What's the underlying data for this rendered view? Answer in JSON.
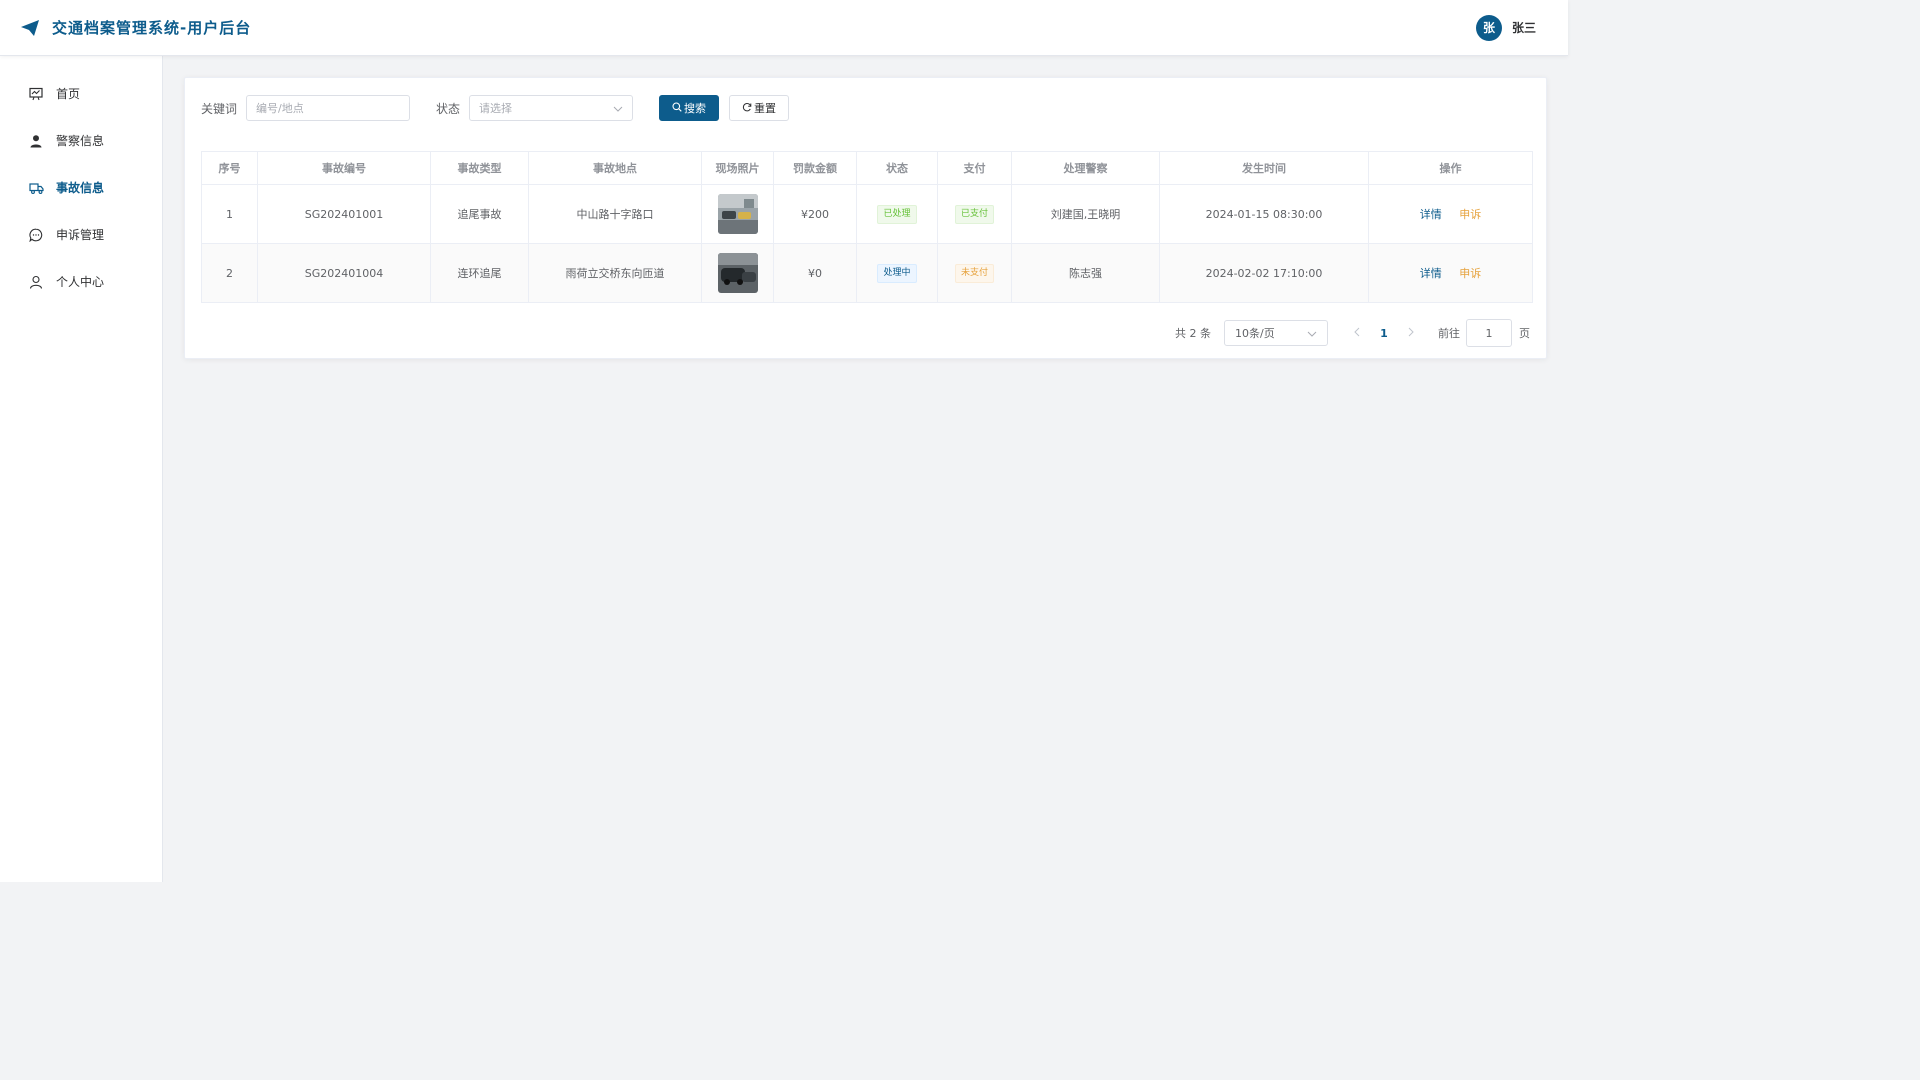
{
  "header": {
    "title": "交通档案管理系统-用户后台",
    "avatar_char": "张",
    "username": "张三"
  },
  "sidebar": {
    "items": [
      {
        "label": "首页",
        "icon": "home-chart-icon"
      },
      {
        "label": "警察信息",
        "icon": "person-icon"
      },
      {
        "label": "事故信息",
        "icon": "truck-icon",
        "active": true
      },
      {
        "label": "申诉管理",
        "icon": "chat-icon"
      },
      {
        "label": "个人中心",
        "icon": "user-outline-icon"
      }
    ]
  },
  "filters": {
    "keyword_label": "关键词",
    "keyword_placeholder": "编号/地点",
    "status_label": "状态",
    "status_placeholder": "请选择",
    "search_label": "搜索",
    "reset_label": "重置"
  },
  "table": {
    "headers": [
      "序号",
      "事故编号",
      "事故类型",
      "事故地点",
      "现场照片",
      "罚款金额",
      "状态",
      "支付",
      "处理警察",
      "发生时间",
      "操作"
    ],
    "rows": [
      {
        "index": "1",
        "code": "SG202401001",
        "type": "追尾事故",
        "location": "中山路十字路口",
        "fine": "¥200",
        "status": "已处理",
        "payment": "已支付",
        "officers": "刘建国,王晓明",
        "time": "2024-01-15 08:30:00",
        "detail": "详情",
        "appeal": "申诉"
      },
      {
        "index": "2",
        "code": "SG202401004",
        "type": "连环追尾",
        "location": "雨荷立交桥东向匝道",
        "fine": "¥0",
        "status": "处理中",
        "payment": "未支付",
        "officers": "陈志强",
        "time": "2024-02-02 17:10:00",
        "detail": "详情",
        "appeal": "申诉"
      }
    ]
  },
  "pagination": {
    "total": "共 2 条",
    "page_size": "10条/页",
    "current": "1",
    "goto_label": "前往",
    "goto_value": "1",
    "unit": "页"
  },
  "colors": {
    "primary": "#0d5c8c",
    "success": "#67c23a",
    "warning": "#e6a23c"
  }
}
